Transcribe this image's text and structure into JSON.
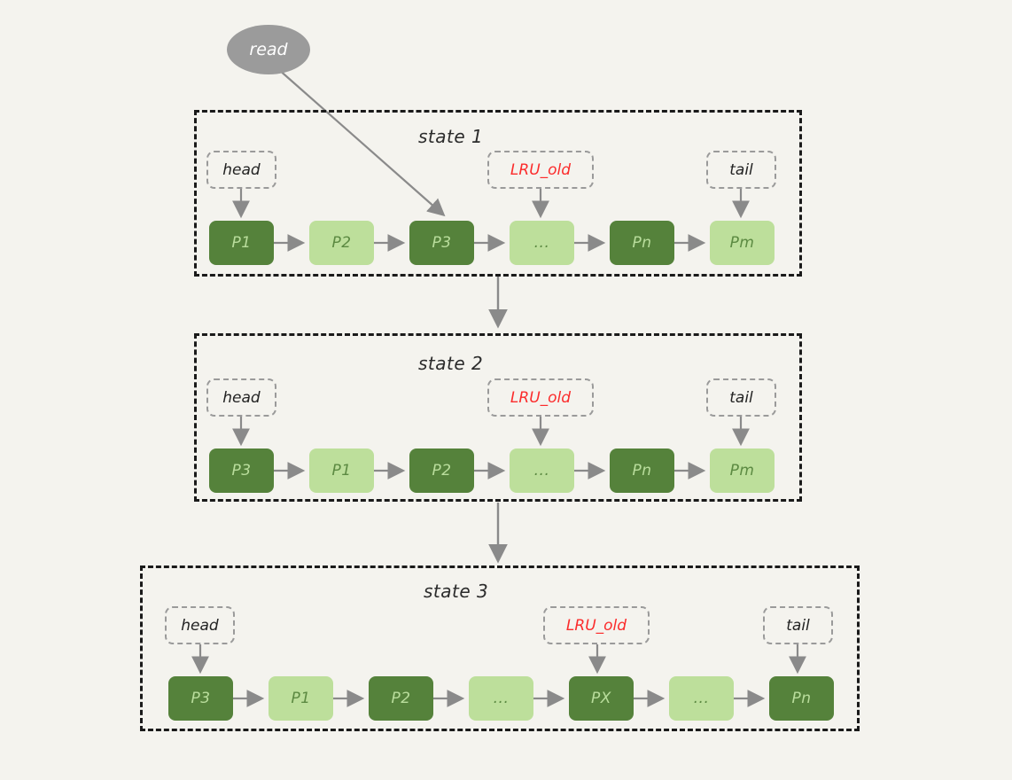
{
  "diagram": {
    "title_hidden": "",
    "background_color": "#f4f3ee",
    "colors": {
      "node_dark": "#55823b",
      "node_dark_text": "#b9dd9c",
      "node_light": "#bddf9b",
      "node_light_text": "#5c8a42",
      "chip_border": "#9a9a9a",
      "chip_text": "#222222",
      "chip_text_highlight": "#fb2c2c",
      "container_border": "#1a1a1a",
      "arrow": "#8a8a8a",
      "read_fill": "#9b9b9b",
      "read_text": "#ffffff"
    }
  },
  "read_node": {
    "label": "read"
  },
  "states": [
    {
      "id": "state-1",
      "title": "state 1",
      "pointers": [
        {
          "name": "head",
          "label": "head",
          "highlight": false
        },
        {
          "name": "lru-old",
          "label": "LRU_old",
          "highlight": true
        },
        {
          "name": "tail",
          "label": "tail",
          "highlight": false
        }
      ],
      "nodes": [
        {
          "label": "P1",
          "style": "dark"
        },
        {
          "label": "P2",
          "style": "light"
        },
        {
          "label": "P3",
          "style": "dark"
        },
        {
          "label": "...",
          "style": "light"
        },
        {
          "label": "Pn",
          "style": "dark"
        },
        {
          "label": "Pm",
          "style": "light"
        }
      ]
    },
    {
      "id": "state-2",
      "title": "state 2",
      "pointers": [
        {
          "name": "head",
          "label": "head",
          "highlight": false
        },
        {
          "name": "lru-old",
          "label": "LRU_old",
          "highlight": true
        },
        {
          "name": "tail",
          "label": "tail",
          "highlight": false
        }
      ],
      "nodes": [
        {
          "label": "P3",
          "style": "dark"
        },
        {
          "label": "P1",
          "style": "light"
        },
        {
          "label": "P2",
          "style": "dark"
        },
        {
          "label": "...",
          "style": "light"
        },
        {
          "label": "Pn",
          "style": "dark"
        },
        {
          "label": "Pm",
          "style": "light"
        }
      ]
    },
    {
      "id": "state-3",
      "title": "state 3",
      "pointers": [
        {
          "name": "head",
          "label": "head",
          "highlight": false
        },
        {
          "name": "lru-old",
          "label": "LRU_old",
          "highlight": true
        },
        {
          "name": "tail",
          "label": "tail",
          "highlight": false
        }
      ],
      "nodes": [
        {
          "label": "P3",
          "style": "dark"
        },
        {
          "label": "P1",
          "style": "light"
        },
        {
          "label": "P2",
          "style": "dark"
        },
        {
          "label": "...",
          "style": "light"
        },
        {
          "label": "PX",
          "style": "dark"
        },
        {
          "label": "...",
          "style": "light"
        },
        {
          "label": "Pn",
          "style": "dark"
        }
      ]
    }
  ]
}
